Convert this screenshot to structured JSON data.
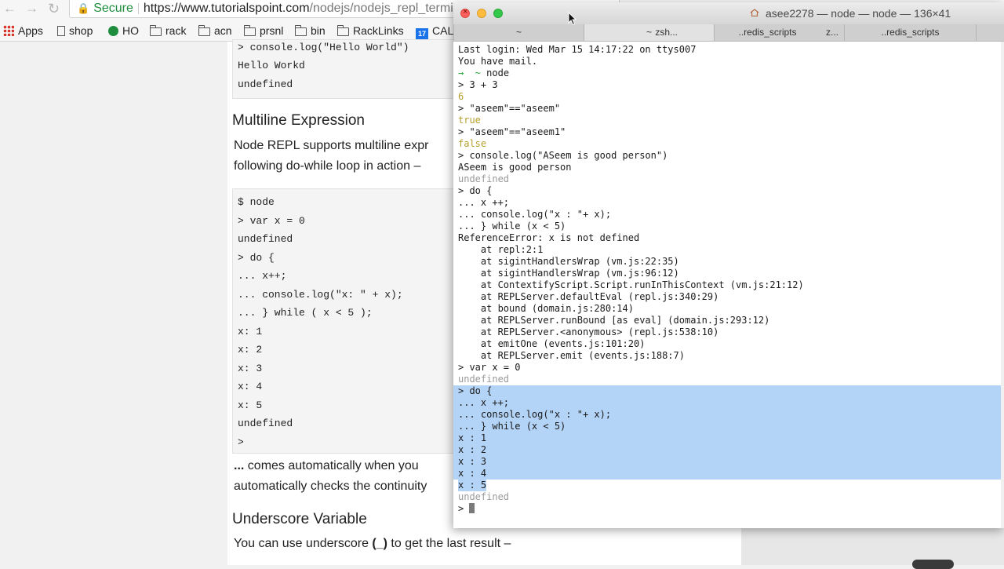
{
  "browser": {
    "back_icon": "←",
    "forward_icon": "→",
    "reload_icon": "↻",
    "secure_label": "Secure",
    "url_host": "https://www.tutorialspoint.com",
    "url_path": "/nodejs/nodejs_repl_termin",
    "bookmarks": [
      {
        "label": "Apps",
        "icon": "apps-grid-icon"
      },
      {
        "label": "shop",
        "icon": "page-icon"
      },
      {
        "label": "HO",
        "icon": "ho-icon"
      },
      {
        "label": "rack",
        "icon": "folder-icon"
      },
      {
        "label": "acn",
        "icon": "folder-icon"
      },
      {
        "label": "prsnl",
        "icon": "folder-icon"
      },
      {
        "label": "bin",
        "icon": "folder-icon"
      },
      {
        "label": "RackLinks",
        "icon": "folder-icon"
      },
      {
        "label": "CAL",
        "icon": "calendar-icon",
        "badge": "17"
      }
    ]
  },
  "article": {
    "code1": [
      "> console.log(\"Hello World\")",
      "Hello Workd",
      "undefined"
    ],
    "heading1": "Multiline Expression",
    "para1_line1": "Node REPL supports multiline expr",
    "para1_line2": "following do-while loop in action –",
    "code2": [
      "$ node",
      "> var x = 0",
      "undefined",
      "> do {",
      "... x++;",
      "... console.log(\"x: \" + x);",
      "... } while ( x < 5 );",
      "x: 1",
      "x: 2",
      "x: 3",
      "x: 4",
      "x: 5",
      "undefined",
      ">"
    ],
    "para2_bold": "...",
    "para2_line1": " comes automatically when you",
    "para2_line2": "automatically checks the continuity",
    "heading2": "Underscore Variable",
    "para3_pre": "You can use underscore ",
    "para3_bold": "(_)",
    "para3_post": " to get the last result –"
  },
  "terminal": {
    "title": "asee2278 — node — node — 136×41",
    "tabs": [
      {
        "label": "~"
      },
      {
        "label": "zsh..."
      },
      {
        "label": "~"
      },
      {
        "label": "..redis_scripts"
      },
      {
        "label": "z..."
      },
      {
        "label": "..redis_scripts"
      }
    ],
    "lines": [
      {
        "t": "Last login: Wed Mar 15 14:17:22 on ttys007",
        "c": ""
      },
      {
        "t": "You have mail.",
        "c": ""
      },
      {
        "t": "→  ~ node",
        "c": "prompt"
      },
      {
        "t": "> 3 + 3",
        "c": ""
      },
      {
        "t": "6",
        "c": "yellow"
      },
      {
        "t": "> \"aseem\"==\"aseem\"",
        "c": ""
      },
      {
        "t": "true",
        "c": "yellow"
      },
      {
        "t": "> \"aseem\"==\"aseem1\"",
        "c": ""
      },
      {
        "t": "false",
        "c": "yellow"
      },
      {
        "t": "> console.log(\"ASeem is good person\")",
        "c": ""
      },
      {
        "t": "ASeem is good person",
        "c": ""
      },
      {
        "t": "undefined",
        "c": "gray"
      },
      {
        "t": "> do {",
        "c": ""
      },
      {
        "t": "... x ++;",
        "c": ""
      },
      {
        "t": "... console.log(\"x : \"+ x);",
        "c": ""
      },
      {
        "t": "... } while (x < 5)",
        "c": ""
      },
      {
        "t": "ReferenceError: x is not defined",
        "c": ""
      },
      {
        "t": "    at repl:2:1",
        "c": ""
      },
      {
        "t": "    at sigintHandlersWrap (vm.js:22:35)",
        "c": ""
      },
      {
        "t": "    at sigintHandlersWrap (vm.js:96:12)",
        "c": ""
      },
      {
        "t": "    at ContextifyScript.Script.runInThisContext (vm.js:21:12)",
        "c": ""
      },
      {
        "t": "    at REPLServer.defaultEval (repl.js:340:29)",
        "c": ""
      },
      {
        "t": "    at bound (domain.js:280:14)",
        "c": ""
      },
      {
        "t": "    at REPLServer.runBound [as eval] (domain.js:293:12)",
        "c": ""
      },
      {
        "t": "    at REPLServer.<anonymous> (repl.js:538:10)",
        "c": ""
      },
      {
        "t": "    at emitOne (events.js:101:20)",
        "c": ""
      },
      {
        "t": "    at REPLServer.emit (events.js:188:7)",
        "c": ""
      },
      {
        "t": "> var x = 0",
        "c": ""
      },
      {
        "t": "undefined",
        "c": "gray"
      },
      {
        "t": "> do {",
        "c": "",
        "sel": true
      },
      {
        "t": "... x ++;",
        "c": "",
        "sel": true
      },
      {
        "t": "... console.log(\"x : \"+ x);",
        "c": "",
        "sel": true
      },
      {
        "t": "... } while (x < 5)",
        "c": "",
        "sel": true
      },
      {
        "t": "x : 1",
        "c": "",
        "sel": true
      },
      {
        "t": "x : 2",
        "c": "",
        "sel": true
      },
      {
        "t": "x : 3",
        "c": "",
        "sel": true
      },
      {
        "t": "x : 4",
        "c": "",
        "sel": true
      },
      {
        "t": "x : 5",
        "c": "",
        "selPartial": true
      },
      {
        "t": "undefined",
        "c": "gray"
      },
      {
        "t": "> ",
        "c": "cursor"
      }
    ]
  }
}
